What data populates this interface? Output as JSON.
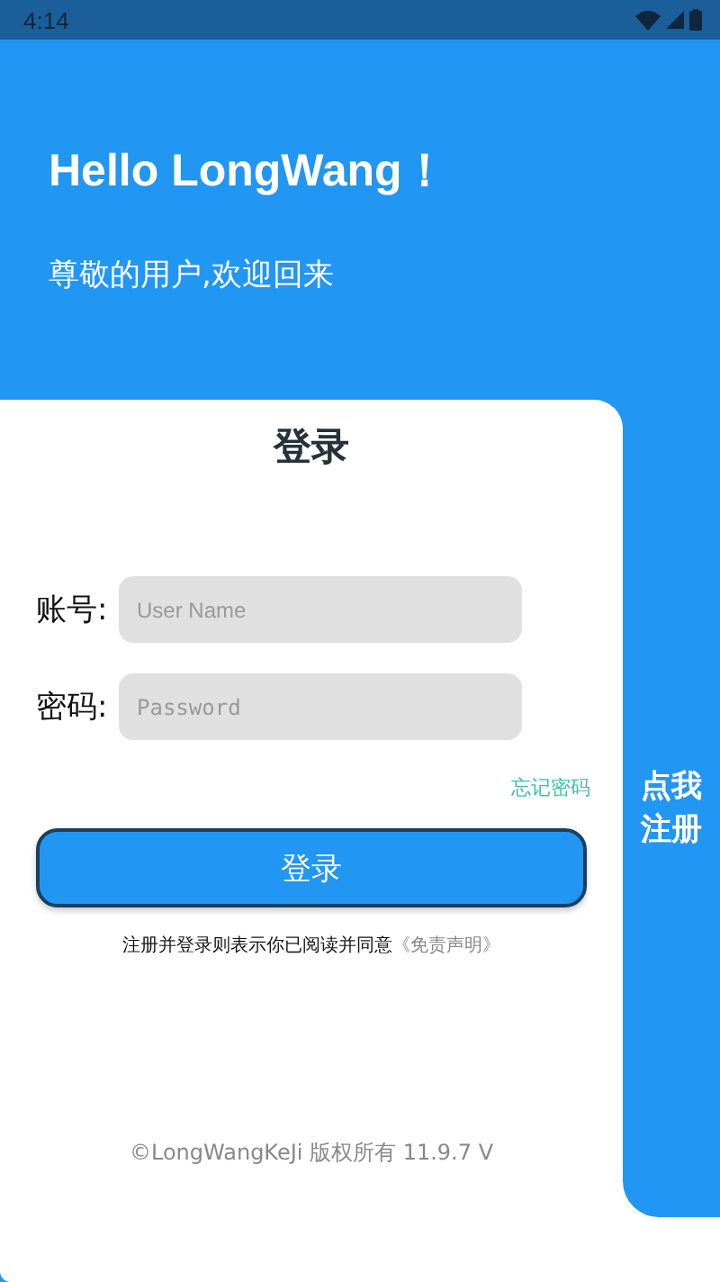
{
  "status_bar": {
    "time": "4:14"
  },
  "header": {
    "greeting": "Hello LongWang！",
    "subtitle": "尊敬的用户,欢迎回来"
  },
  "login_card": {
    "title": "登录",
    "fields": [
      {
        "label": "账号:",
        "placeholder": "User Name",
        "kind": "text"
      },
      {
        "label": "密码:",
        "placeholder": "Password",
        "kind": "password"
      }
    ],
    "forgot_link": "忘记密码",
    "submit": "登录",
    "agreement": "注册并登录则表示你已阅读并同意",
    "agreement_link": "《免责声明》",
    "copyright": "©LongWangKeJi 版权所有 11.9.7 V"
  },
  "register_tab": "点我注册"
}
